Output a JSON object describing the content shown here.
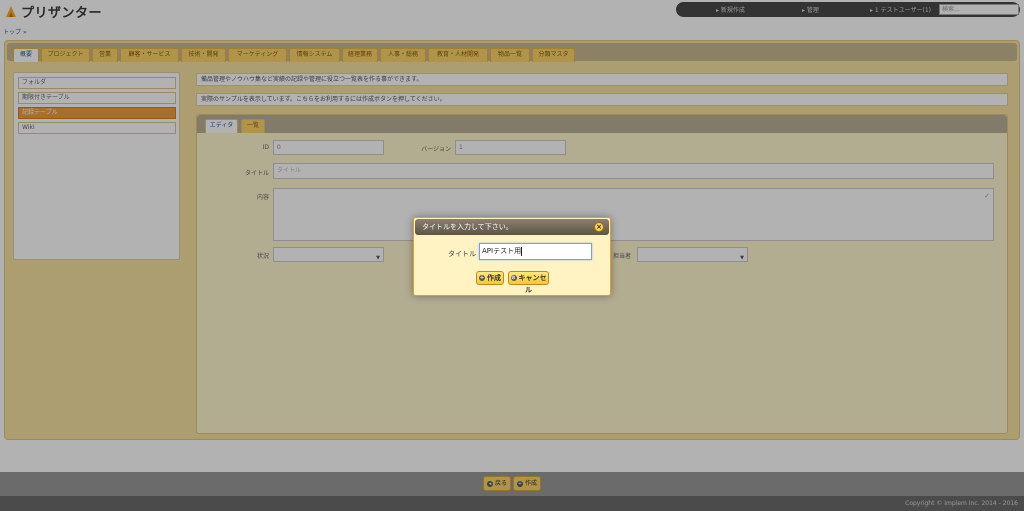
{
  "app": {
    "title": "プリザンター",
    "breadcrumb": "トップ",
    "breadcrumb_sep": "»"
  },
  "topbar": {
    "new_label": "新規作成",
    "admin_label": "管理",
    "user_label": "1 テストユーザー(1)",
    "search_placeholder": "検索..."
  },
  "tabs": [
    {
      "label": "概要"
    },
    {
      "label": "プロジェクト"
    },
    {
      "label": "営業"
    },
    {
      "label": "顧客・サービス"
    },
    {
      "label": "技術・開発"
    },
    {
      "label": "マーケティング"
    },
    {
      "label": "情報システム"
    },
    {
      "label": "経理業務"
    },
    {
      "label": "人事・総務"
    },
    {
      "label": "教育・人材開発"
    },
    {
      "label": "物品一覧"
    },
    {
      "label": "分類マスタ"
    }
  ],
  "sidebar": {
    "items": [
      {
        "label": "フォルダ"
      },
      {
        "label": "期限付きテーブル"
      },
      {
        "label": "記録テーブル"
      },
      {
        "label": "Wiki"
      }
    ]
  },
  "info": {
    "line1": "備品管理やノウハウ集など実績の記録や管理に役立つ一覧表を作る事ができます。",
    "line2": "実際のサンプルを表示しています。こちらをお利用するには作成ボタンを押してください。"
  },
  "panel": {
    "tab_editor": "エディタ",
    "tab_list": "一覧",
    "id_label": "ID",
    "id_value": "0",
    "version_label": "バージョン",
    "version_value": "1",
    "title_label": "タイトル",
    "title_value": "タイトル",
    "body_label": "内容",
    "status_label": "状況",
    "manager_label": "担当者"
  },
  "footer": {
    "back_label": "戻る",
    "create_label": "作成",
    "copyright": "Copyright © Implem Inc. 2014 - 2016"
  },
  "dialog": {
    "title": "タイトルを入力して下さい。",
    "close_glyph": "×",
    "field_label": "タイトル",
    "field_value": "APIテスト用",
    "create_label": "作成",
    "cancel_label": "キャンセル"
  }
}
